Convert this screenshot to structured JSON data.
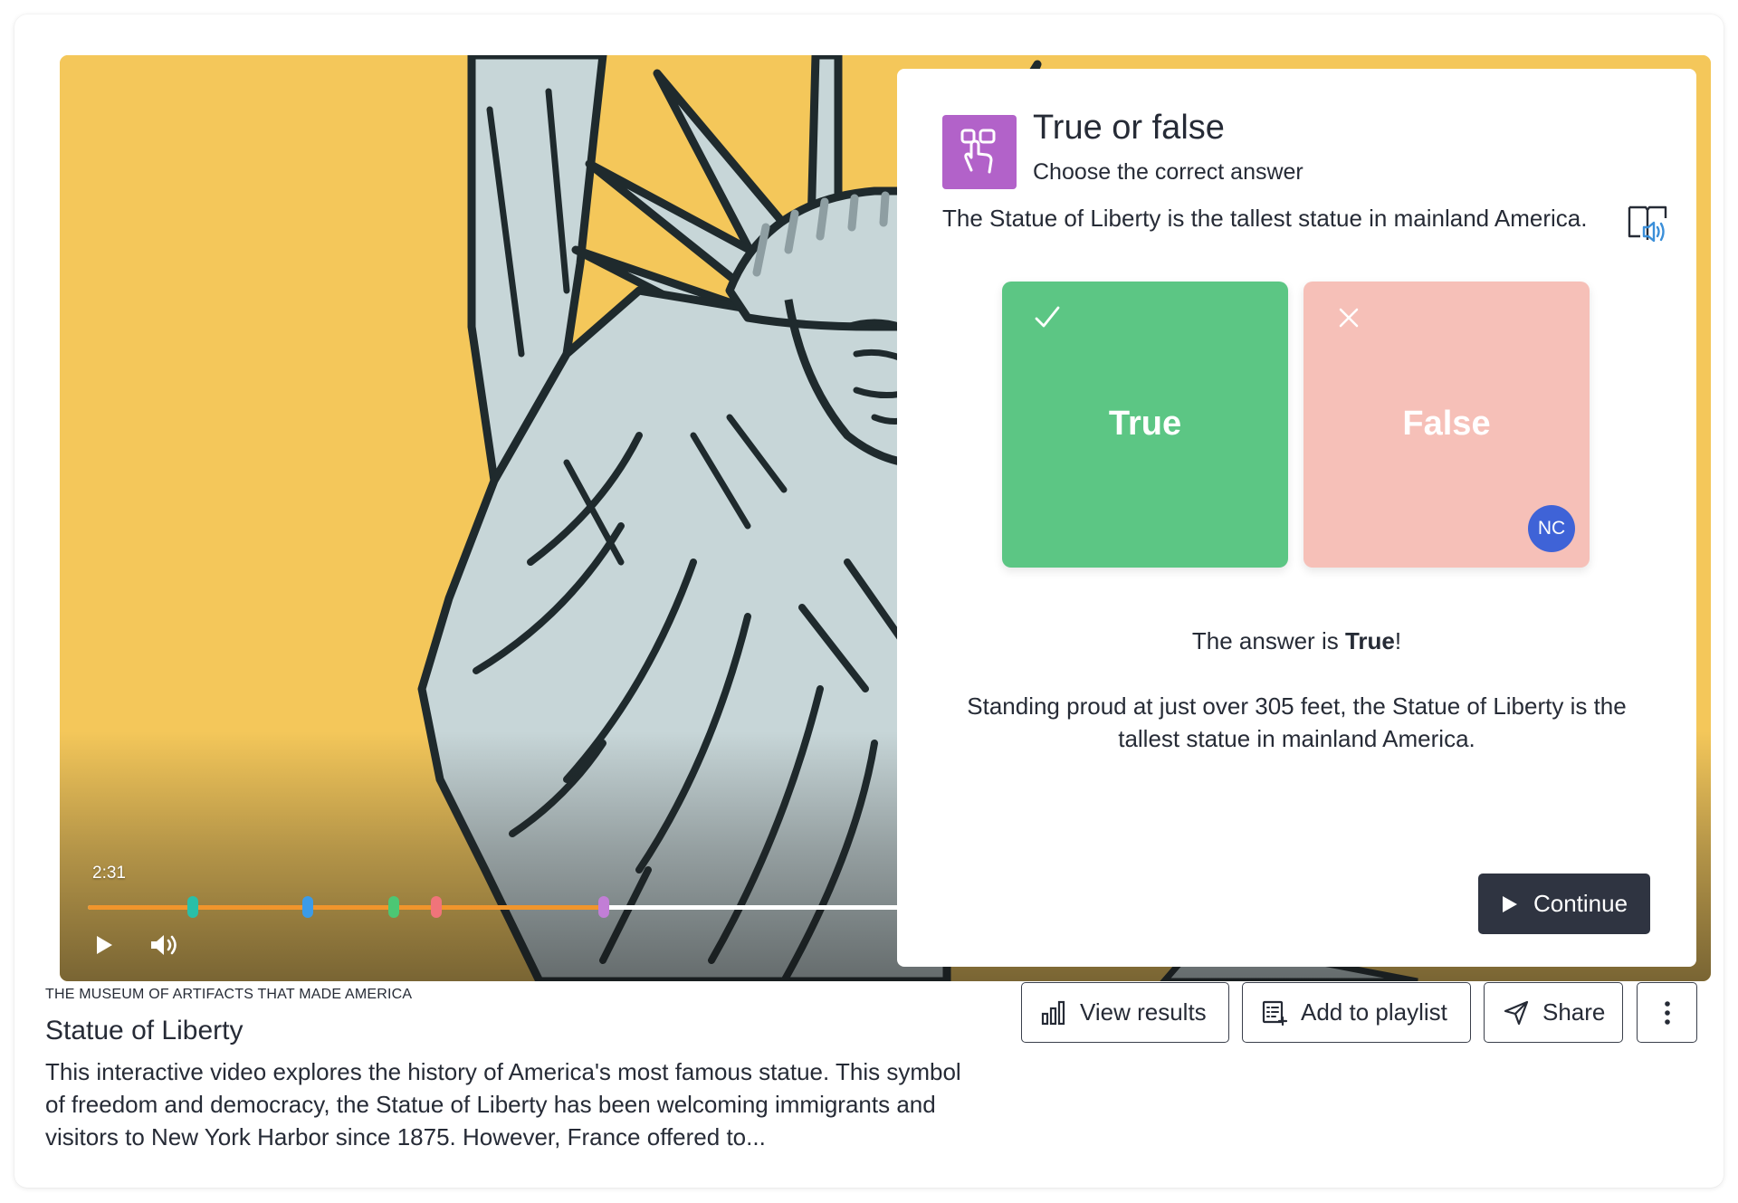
{
  "player": {
    "time": "2:31",
    "progress_fraction": 0.575,
    "markers": [
      {
        "position_fraction": 0.116,
        "color": "#29bfa8"
      },
      {
        "position_fraction": 0.243,
        "color": "#3b9be8"
      },
      {
        "position_fraction": 0.338,
        "color": "#4cc774"
      },
      {
        "position_fraction": 0.385,
        "color": "#f0747a"
      },
      {
        "position_fraction": 0.57,
        "color": "#c27ed6"
      }
    ],
    "play_icon": "play-icon",
    "volume_icon": "volume-icon",
    "colors": {
      "played": "#f0952c",
      "unplayed": "#ffffff",
      "background": "#f4c75a"
    }
  },
  "question": {
    "icon": "touch-select-icon",
    "icon_color": "#b262c9",
    "title": "True or false",
    "subtitle": "Choose the correct answer",
    "text": "The Statue of Liberty is the tallest statue in mainland America.",
    "read_aloud_icon": "read-aloud-icon",
    "options": [
      {
        "label": "True",
        "mark": "checkmark-icon",
        "color": "#5cc684"
      },
      {
        "label": "False",
        "mark": "x-icon",
        "color": "#f6c0b8",
        "avatar": "NC"
      }
    ],
    "answer_prefix": "The answer is ",
    "answer_value": "True",
    "answer_suffix": "!",
    "explanation": "Standing proud at just over 305 feet, the Statue of Liberty is the tallest statue in mainland America.",
    "continue_label": "Continue"
  },
  "video_info": {
    "publisher": "THE MUSEUM OF ARTIFACTS THAT MADE AMERICA",
    "title": "Statue of Liberty",
    "description": "This interactive video explores the history of America's most famous statue. This symbol of freedom and democracy, the Statue of Liberty has been welcoming immigrants and visitors to New York Harbor since 1875. However, France offered to..."
  },
  "actions": {
    "view_results": "View results",
    "add_to_playlist": "Add to playlist",
    "share": "Share",
    "more_icon": "more-vertical-icon"
  },
  "colors": {
    "avatar": "#3f63d7",
    "continue_bg": "#2f3441",
    "text": "#262b36"
  }
}
